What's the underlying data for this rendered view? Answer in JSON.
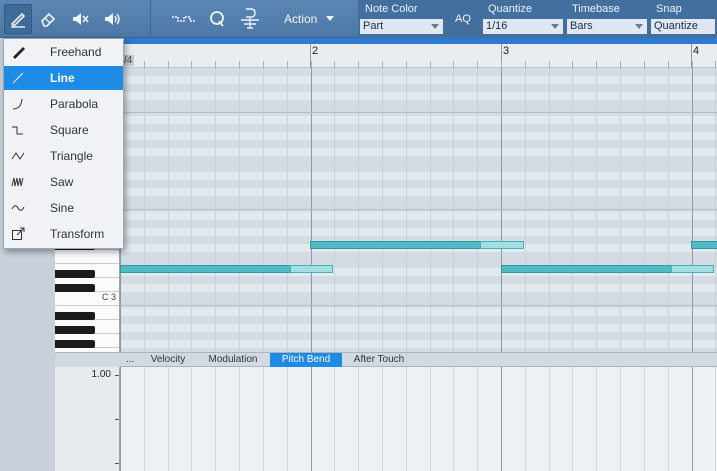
{
  "toolbar": {
    "action_label": "Action",
    "aq_label": "AQ",
    "note_color": {
      "label": "Note Color",
      "value": "Part"
    },
    "quantize": {
      "label": "Quantize",
      "value": "1/16"
    },
    "timebase": {
      "label": "Timebase",
      "value": "Bars"
    },
    "snap": {
      "label": "Snap",
      "value": "Quantize"
    }
  },
  "draw_menu": {
    "selected": "Line",
    "items": [
      {
        "label": "Freehand",
        "icon": "pencil-icon"
      },
      {
        "label": "Line",
        "icon": "line-icon"
      },
      {
        "label": "Parabola",
        "icon": "parabola-icon"
      },
      {
        "label": "Square",
        "icon": "square-wave-icon"
      },
      {
        "label": "Triangle",
        "icon": "triangle-wave-icon"
      },
      {
        "label": "Saw",
        "icon": "saw-wave-icon"
      },
      {
        "label": "Sine",
        "icon": "sine-wave-icon"
      },
      {
        "label": "Transform",
        "icon": "transform-icon"
      }
    ]
  },
  "ruler": {
    "time_signature": "/4",
    "bars": [
      "2",
      "3",
      "4"
    ]
  },
  "keyboard": {
    "c3_label": "C 3"
  },
  "tabs": {
    "more_label": "...",
    "items": [
      "Velocity",
      "Modulation",
      "Pitch Bend",
      "After Touch"
    ],
    "selected": "Pitch Bend"
  },
  "automation_lane": {
    "max_value": "1.00"
  },
  "colors": {
    "accent": "#1e8ce6",
    "toolbar": "#5580ae",
    "note": "#4fbcc4"
  }
}
